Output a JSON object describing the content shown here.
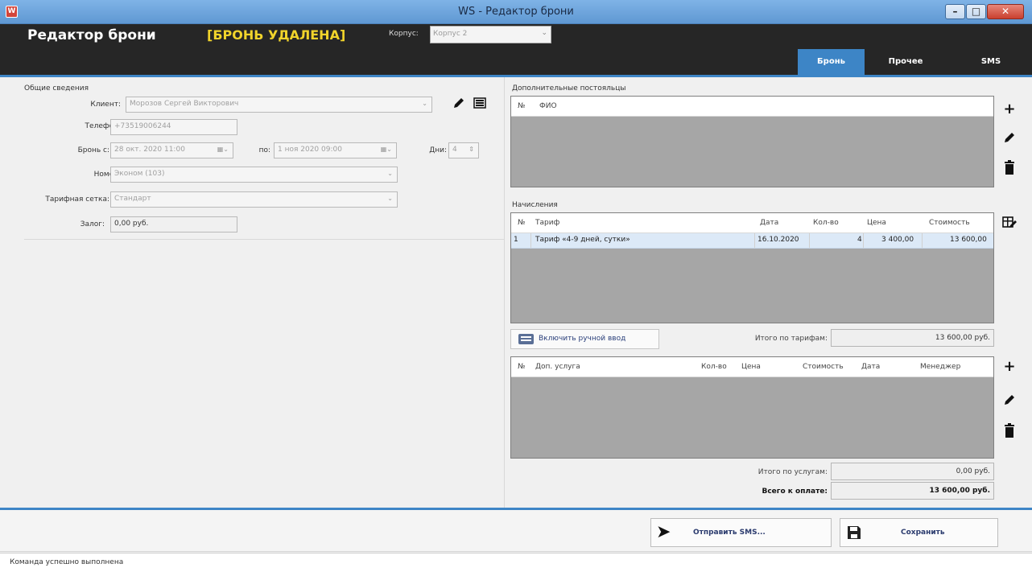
{
  "window": {
    "title": "WS - Редактор брони",
    "app_icon": "W"
  },
  "header": {
    "title": "Редактор брони",
    "status": "[БРОНЬ УДАЛЕНА]",
    "korpus_label": "Корпус:",
    "korpus_value": "Корпус 2",
    "tabs": [
      "Бронь",
      "Прочее",
      "SMS"
    ],
    "active_tab": "Бронь",
    "accent_color": "#3d85c6",
    "status_color": "#f1d42b"
  },
  "general": {
    "title": "Общие сведения",
    "client_label": "Клиент:",
    "client_value": "Морозов Сергей Викторович",
    "phone_label": "Телефон:",
    "phone_value": "+73519006244",
    "from_label": "Бронь с:",
    "from_value": "28 окт. 2020 11:00",
    "to_label": "по:",
    "to_value": "1 ноя 2020 09:00",
    "days_label": "Дни:",
    "days_value": "4",
    "room_label": "Номер:",
    "room_value": "Эконом (103)",
    "tariff_grid_label": "Тарифная сетка:",
    "tariff_grid_value": "Стандарт",
    "deposit_label": "Залог:",
    "deposit_value": "0,00 руб."
  },
  "guests": {
    "title": "Дополнительные постояльцы",
    "columns": [
      "№",
      "ФИО"
    ]
  },
  "charges": {
    "title": "Начисления",
    "columns": [
      "№",
      "Тариф",
      "Дата",
      "Кол-во",
      "Цена",
      "Стоимость"
    ],
    "rows": [
      {
        "n": "1",
        "tariff": "Тариф «4-9 дней, сутки»",
        "date": "16.10.2020",
        "qty": "4",
        "price": "3 400,00",
        "cost": "13 600,00"
      }
    ]
  },
  "manual_input_button": "Включить ручной ввод",
  "tariff_total_label": "Итого по тарифам:",
  "tariff_total_value": "13 600,00 руб.",
  "services": {
    "columns": [
      "№",
      "Доп. услуга",
      "Кол-во",
      "Цена",
      "Стоимость",
      "Дата",
      "Менеджер"
    ]
  },
  "services_total_label": "Итого по услугам:",
  "services_total_value": "0,00 руб.",
  "grand_total_label": "Всего к оплате:",
  "grand_total_value": "13 600,00 руб.",
  "actions": {
    "send_sms": "Отправить SMS...",
    "save": "Сохранить"
  },
  "status_bar": "Команда успешно выполнена"
}
